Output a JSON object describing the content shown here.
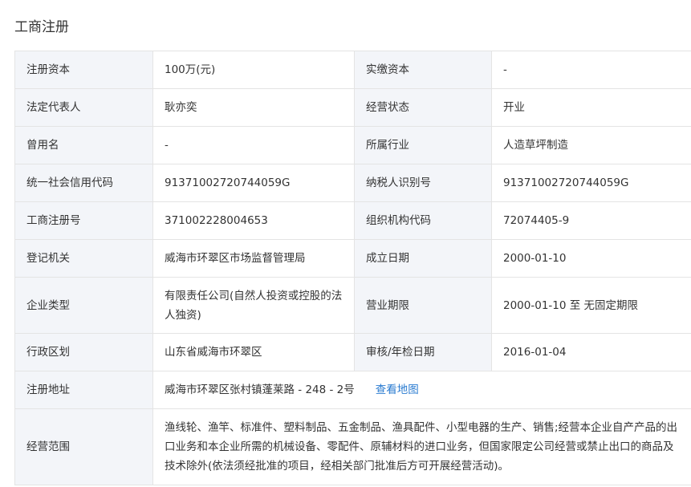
{
  "section_title": "工商注册",
  "rows": [
    {
      "l1": "注册资本",
      "v1": "100万(元)",
      "l2": "实缴资本",
      "v2": "-"
    },
    {
      "l1": "法定代表人",
      "v1": "耿亦奕",
      "l2": "经营状态",
      "v2": "开业"
    },
    {
      "l1": "曾用名",
      "v1": "-",
      "l2": "所属行业",
      "v2": "人造草坪制造"
    },
    {
      "l1": "统一社会信用代码",
      "v1": "91371002720744059G",
      "l2": "纳税人识别号",
      "v2": "91371002720744059G"
    },
    {
      "l1": "工商注册号",
      "v1": "371002228004653",
      "l2": "组织机构代码",
      "v2": "72074405-9"
    },
    {
      "l1": "登记机关",
      "v1": "威海市环翠区市场监督管理局",
      "l2": "成立日期",
      "v2": "2000-01-10"
    },
    {
      "l1": "企业类型",
      "v1": "有限责任公司(自然人投资或控股的法人独资)",
      "l2": "营业期限",
      "v2": "2000-01-10 至 无固定期限"
    },
    {
      "l1": "行政区划",
      "v1": "山东省威海市环翠区",
      "l2": "审核/年检日期",
      "v2": "2016-01-04"
    }
  ],
  "address": {
    "label": "注册地址",
    "value": "威海市环翠区张村镇蓬莱路 - 248 - 2号",
    "map_link": "查看地图"
  },
  "scope": {
    "label": "经营范围",
    "value": "渔线轮、渔竿、标准件、塑料制品、五金制品、渔具配件、小型电器的生产、销售;经营本企业自产产品的出口业务和本企业所需的机械设备、零配件、原辅材料的进口业务，但国家限定公司经营或禁止出口的商品及技术除外(依法须经批准的项目，经相关部门批准后方可开展经营活动)。"
  }
}
